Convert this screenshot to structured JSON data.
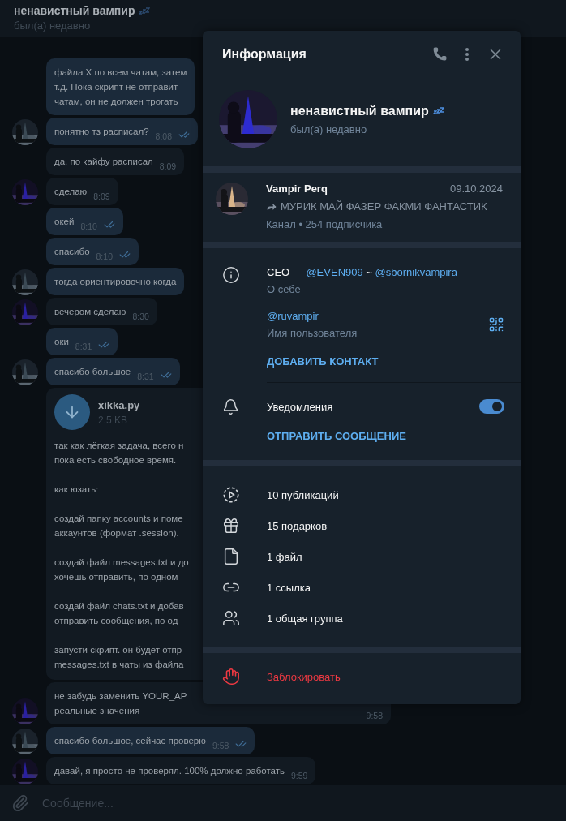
{
  "chat_header": {
    "title": "ненавистный вампир",
    "status": "был(а) недавно"
  },
  "messages": [
    {
      "kind": "text",
      "outgoing": true,
      "avatar": false,
      "text": "файла X по всем чатам, затем\nт.д. Пока скрипт не отправит\nчатам, он не должен трогать"
    },
    {
      "kind": "text",
      "outgoing": true,
      "avatar": true,
      "text": "понятно тз расписал?",
      "time": "8:08",
      "read": true
    },
    {
      "kind": "text",
      "outgoing": false,
      "avatar": false,
      "text": "да, по кайфу расписал",
      "time": "8:09"
    },
    {
      "kind": "text",
      "outgoing": false,
      "avatar": true,
      "text": "сделаю",
      "time": "8:09"
    },
    {
      "kind": "text",
      "outgoing": true,
      "avatar": false,
      "text": "окей",
      "time": "8:10",
      "read": true
    },
    {
      "kind": "text",
      "outgoing": true,
      "avatar": false,
      "text": "спасибо",
      "time": "8:10",
      "read": true
    },
    {
      "kind": "text",
      "outgoing": true,
      "avatar": true,
      "text": "тогда ориентировочно когда"
    },
    {
      "kind": "text",
      "outgoing": false,
      "avatar": true,
      "text": "вечером сделаю",
      "time": "8:30"
    },
    {
      "kind": "text",
      "outgoing": true,
      "avatar": false,
      "text": "оки",
      "time": "8:31",
      "read": true
    },
    {
      "kind": "text",
      "outgoing": true,
      "avatar": true,
      "text": "спасибо большое",
      "time": "8:31",
      "read": true
    },
    {
      "kind": "file",
      "outgoing": false,
      "avatar": false,
      "file_name": "xikka.py",
      "file_size": "2.5 KB",
      "text": "так как лёгкая задача, всего н\nпока есть свободное время.\n\nкак юзать:\n\nсоздай папку accounts и поме\nаккаунтов (формат .session).\n\nсоздай файл messages.txt и до\nхочешь отправить, по одном\n\nсоздай файл chats.txt и добав\nотправить сообщения, по од\n\nзапусти скрипт. он будет отпр\nmessages.txt в чаты из файла"
    },
    {
      "kind": "text",
      "outgoing": false,
      "avatar": true,
      "text": "не забудь заменить YOUR_AP\nреальные значения",
      "time": "9:58"
    },
    {
      "kind": "text",
      "outgoing": true,
      "avatar": true,
      "text": "спасибо большое, сейчас проверю",
      "time": "9:58",
      "read": true
    },
    {
      "kind": "text",
      "outgoing": false,
      "avatar": true,
      "text": "давай, я просто не проверял. 100% должно работать",
      "time": "9:59"
    }
  ],
  "composer": {
    "placeholder": "Сообщение..."
  },
  "info_panel": {
    "title": "Информация",
    "profile": {
      "name": "ненавистный вампир",
      "status": "был(а) недавно"
    },
    "channel": {
      "name": "Vampir Perq",
      "date": "09.10.2024",
      "post": "МУРИК МАЙ ФАЗЕР ФАКМИ ФАНТАСТИК",
      "meta": "Канал • 254 подписчика"
    },
    "bio_parts": [
      {
        "kind": "text",
        "text": "CEO —"
      },
      {
        "kind": "link",
        "text": "@EVEN909"
      },
      {
        "kind": "text",
        "text": "~"
      },
      {
        "kind": "link",
        "text": "@sbornikvampira"
      }
    ],
    "bio_label": "О себе",
    "username": "@ruvampir",
    "username_label": "Имя пользователя",
    "add_contact": "ДОБАВИТЬ КОНТАКТ",
    "notifications": {
      "label": "Уведомления",
      "on": true
    },
    "send_message": "ОТПРАВИТЬ СООБЩЕНИЕ",
    "media": [
      {
        "kind": "posts",
        "label": "10 публикаций"
      },
      {
        "kind": "gifts",
        "label": "15 подарков"
      },
      {
        "kind": "files",
        "label": "1 файл"
      },
      {
        "kind": "links",
        "label": "1 ссылка"
      },
      {
        "kind": "groups",
        "label": "1 общая группа"
      }
    ],
    "block": "Заблокировать"
  }
}
